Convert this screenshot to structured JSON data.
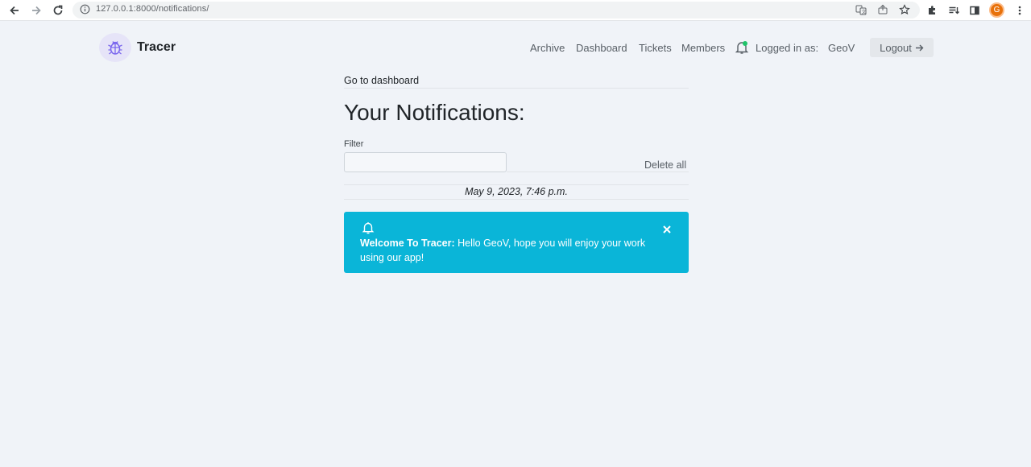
{
  "browser": {
    "url": "127.0.0.1:8000/notifications/",
    "profile_initial": "G"
  },
  "navbar": {
    "brand": "Tracer",
    "links": [
      "Archive",
      "Dashboard",
      "Tickets",
      "Members"
    ],
    "logged_in_label": "Logged in as:",
    "username": "GeoV",
    "logout_label": "Logout",
    "logout_icon": "arrow-right-icon"
  },
  "main": {
    "go_to_dashboard": "Go to dashboard",
    "title": "Your Notifications:",
    "filter_label": "Filter",
    "filter_value": "",
    "delete_all": "Delete all",
    "notifications": [
      {
        "date": "May 9, 2023, 7:46 p.m.",
        "heading": "Welcome To Tracer:",
        "message": "Hello GeoV, hope you will enjoy your work using our app!",
        "icon": "bell-icon",
        "color": "#0ab5d8"
      }
    ]
  },
  "colors": {
    "background": "#f0f3f8",
    "alert_info": "#0ab5d8",
    "unread_dot": "#20c46a",
    "profile": "#e8710a"
  }
}
